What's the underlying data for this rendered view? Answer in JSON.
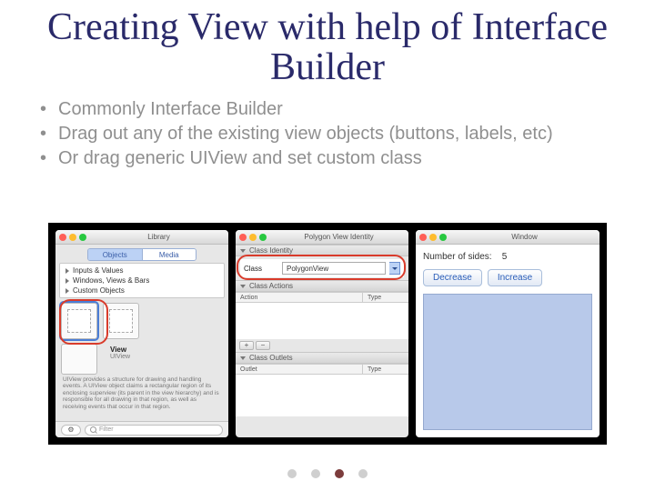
{
  "title": "Creating View with help of Interface Builder",
  "bullets": [
    "Commonly Interface Builder",
    " Drag out any of the existing view objects (buttons, labels, etc)",
    "Or drag generic UIView and set custom class"
  ],
  "left": {
    "window_title": "Library",
    "seg": {
      "a": "Objects",
      "b": "Media"
    },
    "outline": [
      "Inputs & Values",
      "Windows, Views & Bars",
      "Custom Objects"
    ],
    "view_card": {
      "name": "View",
      "subtitle": "UIView"
    },
    "description": "UIView provides a structure for drawing and handling events. A UIView object claims a rectangular region of its enclosing superview (its parent in the view hierarchy) and is responsible for all drawing in that region, as well as receiving events that occur in that region.",
    "search_placeholder": "Filter"
  },
  "middle": {
    "window_title": "Polygon View Identity",
    "section_identity": "Class Identity",
    "class_label": "Class",
    "class_value": "PolygonView",
    "section_actions": "Class Actions",
    "actions_hdr": {
      "a": "Action",
      "b": "Type"
    },
    "section_outlets": "Class Outlets",
    "outlets_hdr": {
      "a": "Outlet",
      "b": "Type"
    }
  },
  "right": {
    "window_title": "Window",
    "sides_label": "Number of sides:",
    "sides_value": "5",
    "decrease": "Decrease",
    "increase": "Increase"
  },
  "icons": {
    "gear": "⚙",
    "plus": "+",
    "minus": "−",
    "chevrons": "⇅"
  }
}
